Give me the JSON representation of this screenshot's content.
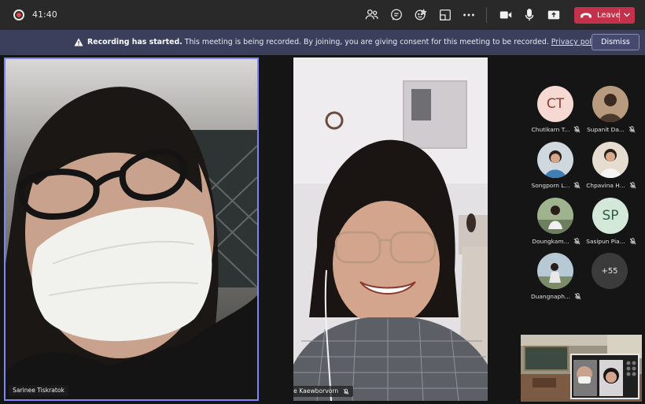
{
  "call": {
    "timer": "41:40",
    "leave_label": "Leave"
  },
  "icons": {
    "recording": "recording-indicator-icon",
    "participants": "participants-icon",
    "chat": "chat-icon",
    "reactions": "reactions-icon",
    "rooms": "breakout-rooms-icon",
    "more": "more-options-icon",
    "camera": "camera-icon",
    "mic": "microphone-icon",
    "share": "share-screen-icon",
    "leave": "phone-hangup-icon",
    "muted": "mic-muted-icon",
    "warning": "warning-icon"
  },
  "banner": {
    "title": "Recording has started.",
    "message": "This meeting is being recorded. By joining, you are giving consent for this meeting to be recorded.",
    "link": "Privacy policy",
    "dismiss_label": "Dismiss"
  },
  "videos": [
    {
      "name": "Sarinee Tiskratok",
      "muted": false
    },
    {
      "name": "Pimrapee Kaewborvorn",
      "muted": true
    }
  ],
  "roster": [
    {
      "name": "Chutikarn T...",
      "initials": "CT",
      "color": "#f7d9d3",
      "text_color": "#8a3b2d"
    },
    {
      "name": "Supanit Da...",
      "initials": "",
      "color": "#6b5a4a"
    },
    {
      "name": "Songporn L...",
      "initials": "",
      "color": "#9fb4c6"
    },
    {
      "name": "Chpavina H...",
      "initials": "",
      "color": "#c7b19a"
    },
    {
      "name": "Doungkam...",
      "initials": "",
      "color": "#a9b8a6"
    },
    {
      "name": "Sasipun Pia...",
      "initials": "SP",
      "color": "#d4e8d9",
      "text_color": "#2f5d44"
    },
    {
      "name": "Duangnaph...",
      "initials": "",
      "color": "#9aa7b5"
    }
  ],
  "overflow_count": "+55",
  "colors": {
    "accent": "#7f85f5",
    "leave": "#c4314b",
    "banner": "#3b3f5c",
    "topbar": "#292929"
  }
}
